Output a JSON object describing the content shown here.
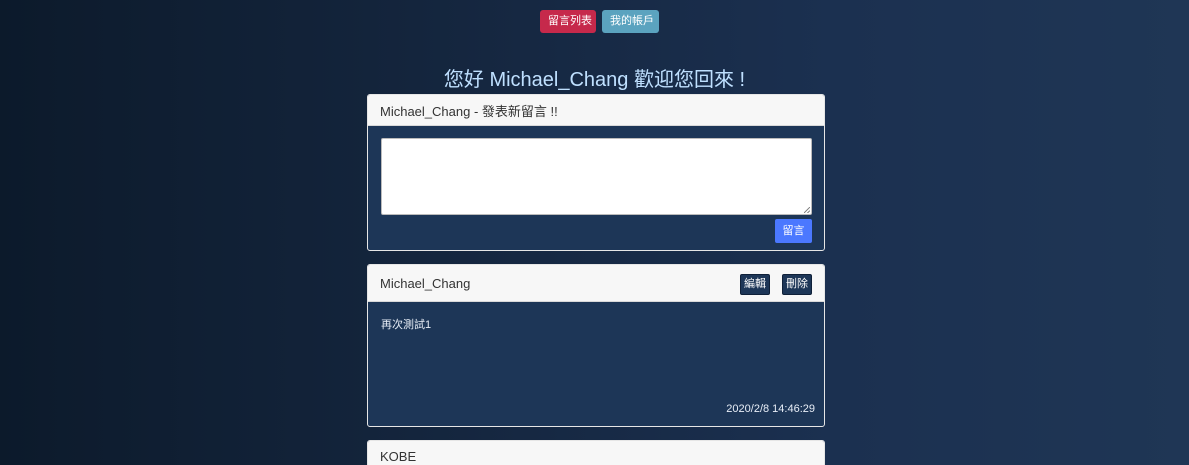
{
  "nav": {
    "message_list_label": "留言列表",
    "my_account_label": "我的帳戶"
  },
  "welcome": {
    "text": "您好 Michael_Chang 歡迎您回來 !"
  },
  "new_message": {
    "header": "Michael_Chang - 發表新留言 !!",
    "textarea_value": "",
    "submit_label": "留言"
  },
  "messages": [
    {
      "author": "Michael_Chang",
      "edit_label": "編輯",
      "delete_label": "刪除",
      "content": "再次測試1",
      "timestamp": "2020/2/8 14:46:29"
    },
    {
      "author": "KOBE"
    }
  ],
  "colors": {
    "nav_primary": "#c6294b",
    "nav_secondary": "#5ba3bf",
    "submit": "#4b78ff",
    "card_body": "#1d3657"
  }
}
